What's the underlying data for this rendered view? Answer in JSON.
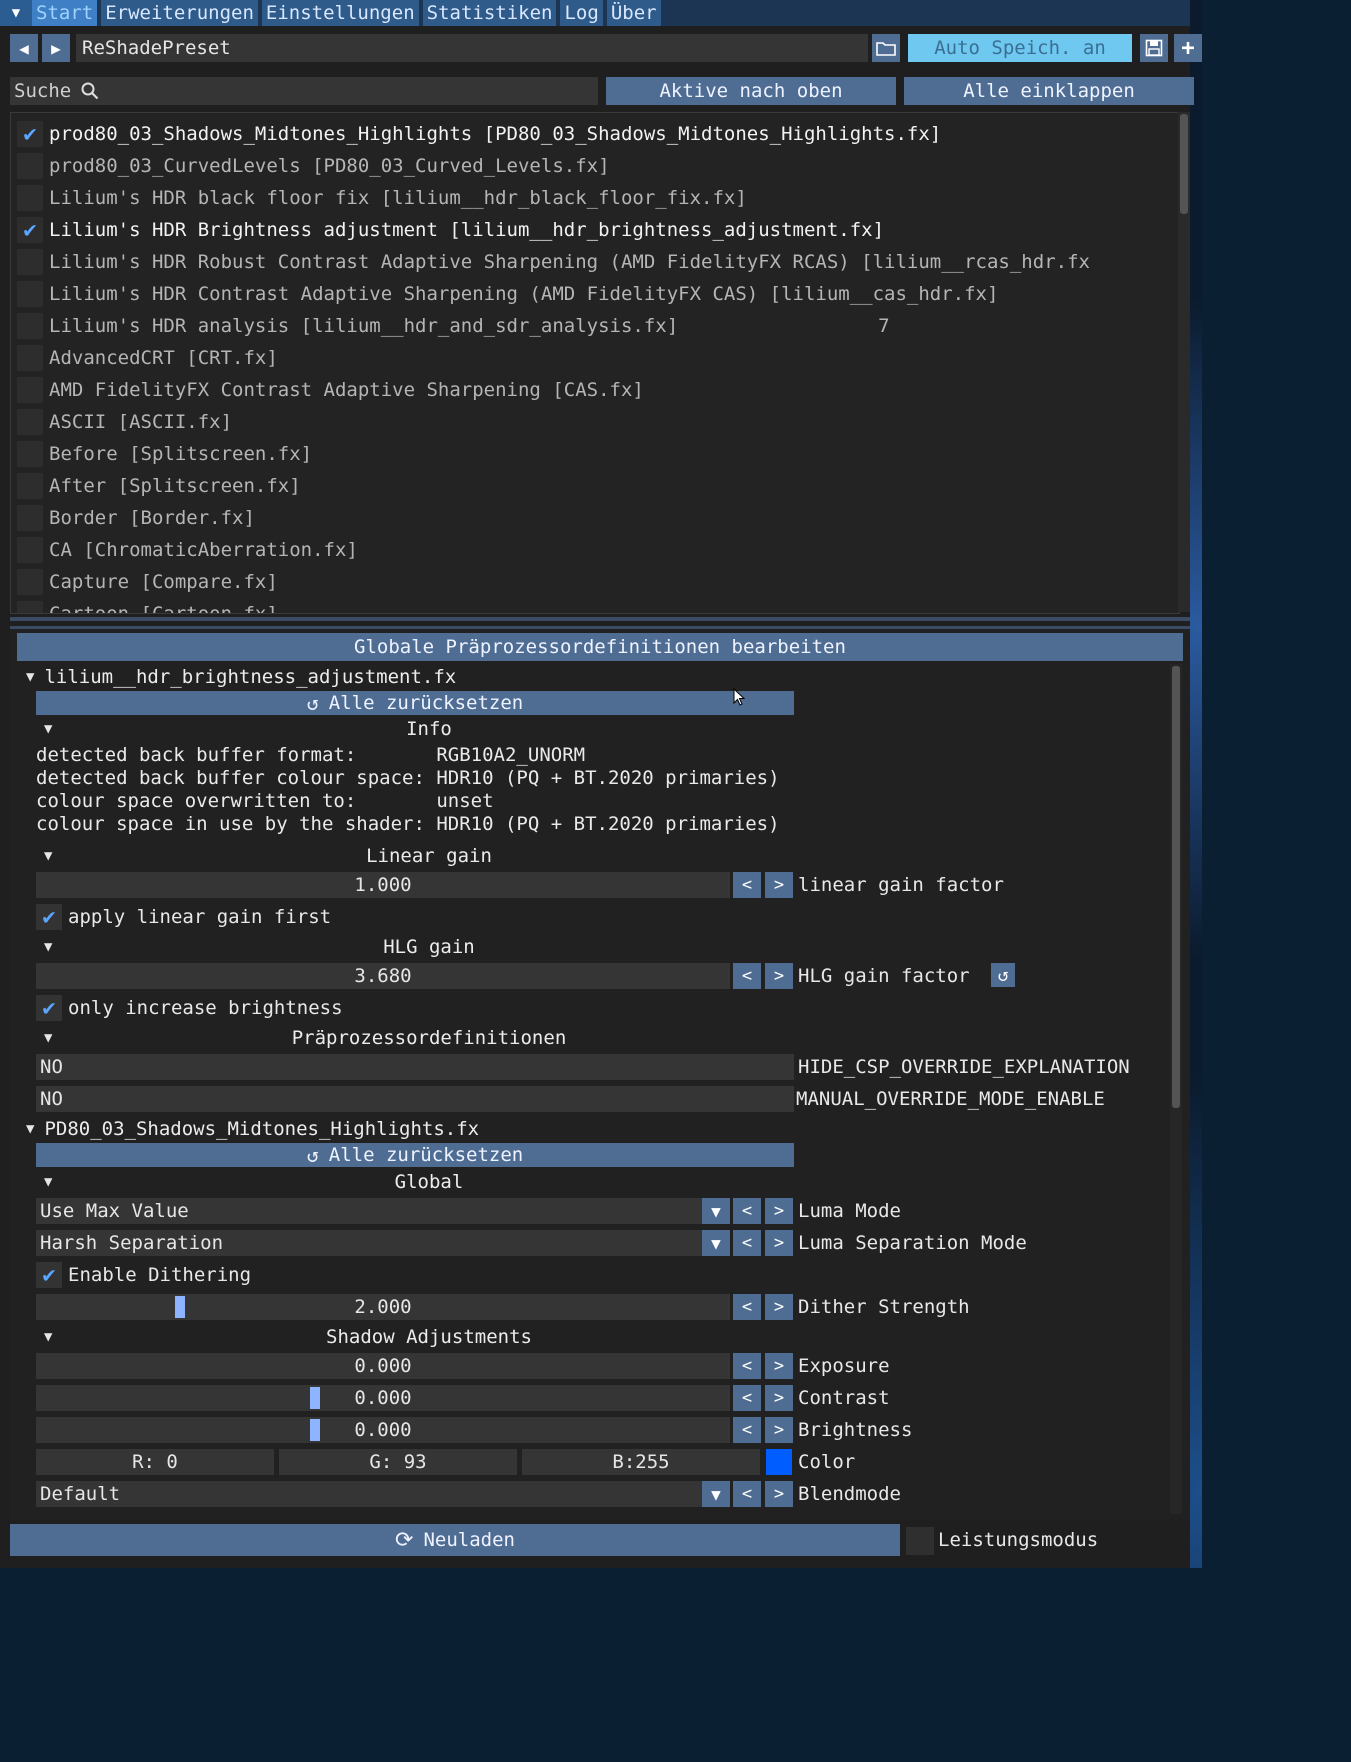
{
  "menubar": {
    "tabs": [
      "Start",
      "Erweiterungen",
      "Einstellungen",
      "Statistiken",
      "Log",
      "Über"
    ],
    "active_index": 0
  },
  "toolbar": {
    "preset_name": "ReShadePreset",
    "auto_save_label": "Auto Speich. an"
  },
  "search": {
    "label": "Suche",
    "active_up_label": "Aktive nach oben",
    "collapse_label": "Alle einklappen"
  },
  "effects": [
    {
      "label": "prod80_03_Shadows_Midtones_Highlights [PD80_03_Shadows_Midtones_Highlights.fx]",
      "checked": true
    },
    {
      "label": "prod80_03_CurvedLevels [PD80_03_Curved_Levels.fx]",
      "checked": false
    },
    {
      "label": "Lilium's HDR black floor fix [lilium__hdr_black_floor_fix.fx]",
      "checked": false
    },
    {
      "label": "Lilium's HDR Brightness adjustment [lilium__hdr_brightness_adjustment.fx]",
      "checked": true
    },
    {
      "label": "Lilium's HDR Robust Contrast Adaptive Sharpening (AMD FidelityFX RCAS) [lilium__rcas_hdr.fx",
      "checked": false
    },
    {
      "label": "Lilium's HDR Contrast Adaptive Sharpening (AMD FidelityFX CAS) [lilium__cas_hdr.fx]",
      "checked": false
    },
    {
      "label": "Lilium's HDR analysis [lilium__hdr_and_sdr_analysis.fx]",
      "checked": false,
      "extra": "7"
    },
    {
      "label": "AdvancedCRT [CRT.fx]",
      "checked": false
    },
    {
      "label": "AMD FidelityFX Contrast Adaptive Sharpening [CAS.fx]",
      "checked": false
    },
    {
      "label": "ASCII [ASCII.fx]",
      "checked": false
    },
    {
      "label": "Before [Splitscreen.fx]",
      "checked": false
    },
    {
      "label": "After [Splitscreen.fx]",
      "checked": false
    },
    {
      "label": "Border [Border.fx]",
      "checked": false
    },
    {
      "label": "CA [ChromaticAberration.fx]",
      "checked": false
    },
    {
      "label": "Capture [Compare.fx]",
      "checked": false
    },
    {
      "label": "Cartoon [Cartoon.fx]",
      "checked": false
    }
  ],
  "global_defs_label": "Globale Präprozessordefinitionen bearbeiten",
  "shader1": {
    "file": "lilium__hdr_brightness_adjustment.fx",
    "reset_all": "Alle zurücksetzen",
    "info_title": "Info",
    "info_lines": [
      "detected back buffer format:       RGB10A2_UNORM",
      "detected back buffer colour space: HDR10 (PQ + BT.2020 primaries)",
      "colour space overwritten to:       unset",
      "colour space in use by the shader: HDR10 (PQ + BT.2020 primaries)"
    ],
    "linear_gain_title": "Linear gain",
    "linear_gain_value": "1.000",
    "linear_gain_label": "linear gain factor",
    "apply_linear_first": "apply linear gain first",
    "hlg_gain_title": "HLG gain",
    "hlg_gain_value": "3.680",
    "hlg_gain_label": "HLG gain factor",
    "only_increase": "only increase brightness",
    "preproc_title": "Präprozessordefinitionen",
    "preproc": [
      {
        "value": "NO",
        "name": "HIDE_CSP_OVERRIDE_EXPLANATION"
      },
      {
        "value": "NO",
        "name": "MANUAL_OVERRIDE_MODE_ENABLE"
      }
    ]
  },
  "shader2": {
    "file": "PD80_03_Shadows_Midtones_Highlights.fx",
    "reset_all": "Alle zurücksetzen",
    "global_title": "Global",
    "luma_mode_value": "Use Max Value",
    "luma_mode_label": "Luma Mode",
    "luma_sep_value": "Harsh Separation",
    "luma_sep_label": "Luma Separation Mode",
    "dithering_label": "Enable Dithering",
    "dither_value": "2.000",
    "dither_fraction": 0.2,
    "dither_label": "Dither Strength",
    "shadow_title": "Shadow Adjustments",
    "exposure_value": "0.000",
    "exposure_label": "Exposure",
    "contrast_value": "0.000",
    "contrast_label": "Contrast",
    "brightness_value": "0.000",
    "brightness_label": "Brightness",
    "color_r": "R:  0",
    "color_g": "G: 93",
    "color_b": "B:255",
    "color_label": "Color",
    "color_hex": "#005dff",
    "blend_value": "Default",
    "blend_label": "Blendmode"
  },
  "bottom": {
    "reload_label": "Neuladen",
    "perf_label": "Leistungsmodus"
  }
}
